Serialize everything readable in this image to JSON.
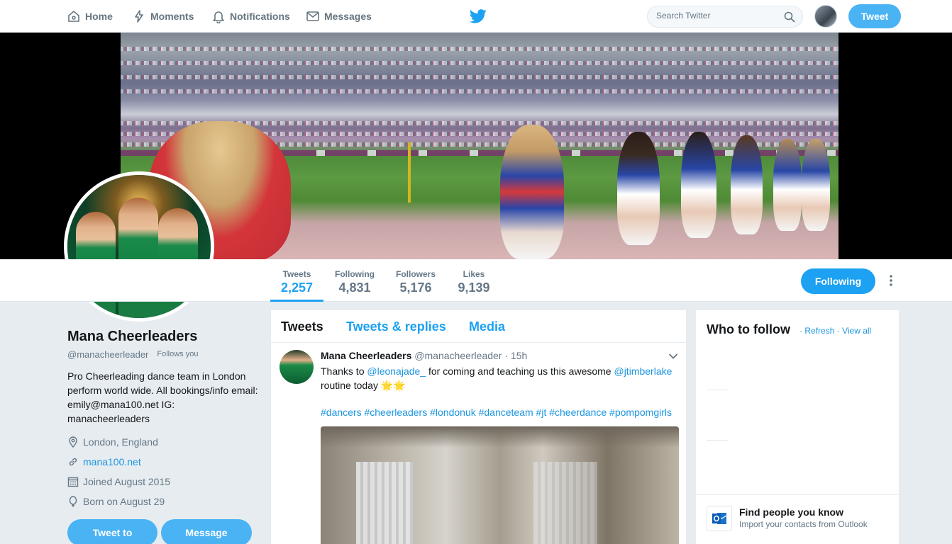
{
  "nav": {
    "home": "Home",
    "moments": "Moments",
    "notifications": "Notifications",
    "messages": "Messages",
    "search_placeholder": "Search Twitter",
    "tweet_button": "Tweet"
  },
  "profile": {
    "name": "Mana Cheerleaders",
    "handle": "@manacheerleader",
    "follows_you": "Follows you",
    "bio": "Pro Cheerleading dance team in London perform world wide. All bookings/info email: emily@mana100.net IG: manacheerleaders",
    "location": "London, England",
    "website": "mana100.net",
    "joined": "Joined August 2015",
    "born": "Born on August 29",
    "tweet_to_button": "Tweet to",
    "message_button": "Message"
  },
  "stats": {
    "tweets_label": "Tweets",
    "tweets_value": "2,257",
    "following_label": "Following",
    "following_value": "4,831",
    "followers_label": "Followers",
    "followers_value": "5,176",
    "likes_label": "Likes",
    "likes_value": "9,139",
    "following_button": "Following"
  },
  "timeline": {
    "tabs": [
      "Tweets",
      "Tweets & replies",
      "Media"
    ],
    "tweet": {
      "name": "Mana Cheerleaders",
      "handle": "@manacheerleader",
      "sep": "·",
      "time": "15h",
      "text_1": "Thanks to ",
      "mention_1": "@leonajade_",
      "text_2": " for coming and teaching us this awesome ",
      "mention_2": "@jtimberlake",
      "text_3": " routine today",
      "emoji": "🌟🌟",
      "hashtags": "#dancers #cheerleaders #londonuk #danceteam #jt #cheerdance #pompomgirls"
    }
  },
  "who_to_follow": {
    "title": "Who to follow",
    "sep": "·",
    "refresh": "Refresh",
    "view_all": "View all",
    "find_title": "Find people you know",
    "find_sub": "Import your contacts from Outlook"
  },
  "colors": {
    "accent": "#1da1f2",
    "button": "#4ab3f4",
    "link": "#1b95e0",
    "muted": "#657786",
    "page_bg": "#e6ecf0"
  }
}
